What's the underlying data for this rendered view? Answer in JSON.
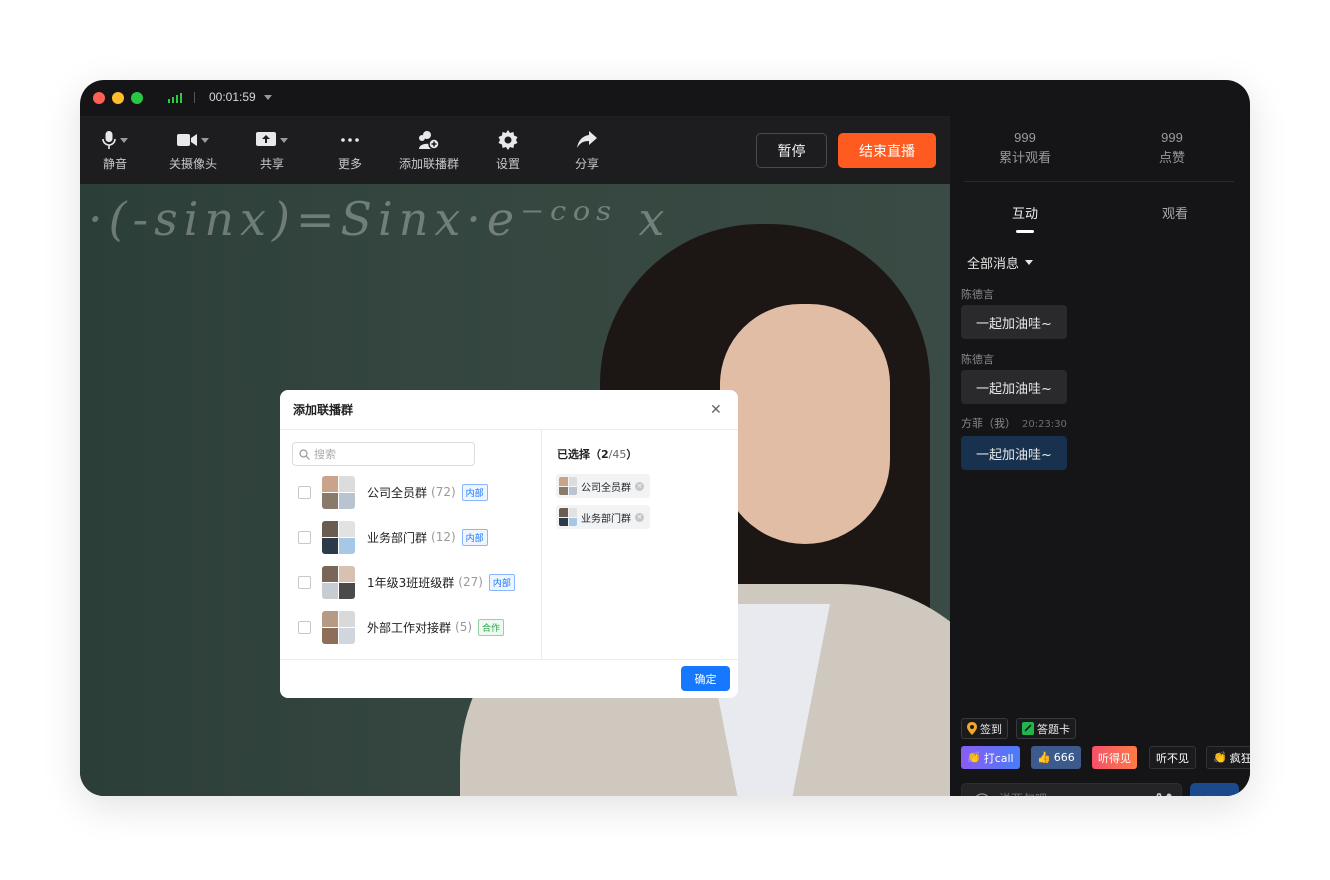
{
  "titlebar": {
    "timer": "00:01:59"
  },
  "toolbar": {
    "mute_label": "静音",
    "camera_label": "关摄像头",
    "share_label": "共享",
    "more_label": "更多",
    "add_group_label": "添加联播群",
    "settings_label": "设置",
    "forward_label": "分享",
    "pause_label": "暂停",
    "end_label": "结束直播",
    "end_color": "#ff5a1f"
  },
  "video": {
    "board_text": "·(-sinx)=Sinx·e⁻ᶜᵒˢ x"
  },
  "dialog": {
    "title": "添加联播群",
    "search_placeholder": "搜索",
    "groups": [
      {
        "name": "公司全员群",
        "count": "(72)",
        "tag": "内部",
        "tag_type": "blue"
      },
      {
        "name": "业务部门群",
        "count": "(12)",
        "tag": "内部",
        "tag_type": "blue"
      },
      {
        "name": "1年级3班班级群",
        "count": "(27)",
        "tag": "内部",
        "tag_type": "blue"
      },
      {
        "name": "外部工作对接群",
        "count": "(5)",
        "tag": "合作",
        "tag_type": "green"
      }
    ],
    "selected_title": "已选择（",
    "selected_count": "2",
    "selected_total": "/45",
    "selected_close": "）",
    "selected": [
      {
        "name": "公司全员群"
      },
      {
        "name": "业务部门群"
      }
    ],
    "confirm_label": "确定",
    "accent": "#1677ff"
  },
  "panel": {
    "views_value": "999",
    "views_label": "累计观看",
    "likes_value": "999",
    "likes_label": "点赞",
    "tab_interact": "互动",
    "tab_watch": "观看",
    "filter_label": "全部消息",
    "messages": [
      {
        "sender": "陈德言",
        "time": "",
        "text": "一起加油哇~",
        "mine": false
      },
      {
        "sender": "陈德言",
        "time": "",
        "text": "一起加油哇~",
        "mine": false
      },
      {
        "sender": "方菲（我）",
        "time": "20:23:30",
        "text": "一起加油哇~",
        "mine": true
      }
    ],
    "checkin_label": "签到",
    "answer_card_label": "答题卡",
    "reactions": [
      {
        "label": "打call",
        "icon": "clap-icon",
        "color": "#6f5cf5"
      },
      {
        "label": "666",
        "icon": "thumb-icon",
        "color": "#3c5a8c"
      },
      {
        "label": "听得见",
        "icon": "",
        "color": "#f0586f"
      },
      {
        "label": "听不见",
        "icon": "",
        "color": "#1b1b1e"
      },
      {
        "label": "疯狂",
        "icon": "clap-icon",
        "color": "#1b1b1e"
      }
    ],
    "input_placeholder": "说两句吧~",
    "send_label": "发送"
  }
}
